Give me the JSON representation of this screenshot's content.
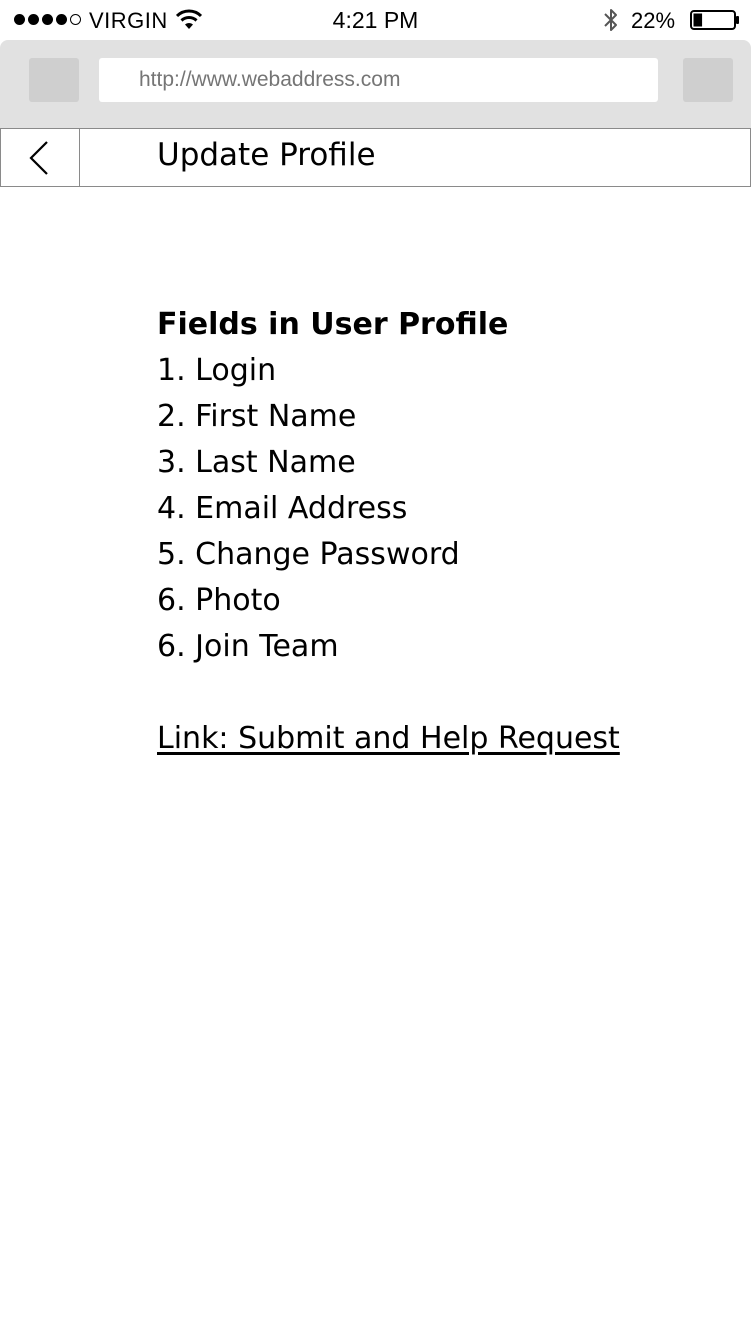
{
  "status_bar": {
    "carrier": "VIRGIN",
    "time": "4:21 PM",
    "battery_percent": "22%",
    "battery_level": 0.22,
    "signal_bars_filled": 4,
    "signal_bars_total": 5,
    "icons": [
      "wifi-icon",
      "bluetooth-icon",
      "battery-icon"
    ]
  },
  "browser": {
    "url_placeholder": "http://www.webaddress.com"
  },
  "header": {
    "back_icon": "chevron-left-icon",
    "title": "Update Profile"
  },
  "main": {
    "heading": "Fields in User Profile",
    "fields": [
      "1. Login",
      "2. First Name",
      "3. Last Name",
      "4. Email Address",
      "5. Change Password",
      "6. Photo",
      "6. Join Team"
    ],
    "help_link": "Link: Submit and Help Request"
  },
  "colors": {
    "chrome_gray": "#e1e1e1",
    "button_gray": "#cfcfcf",
    "border_gray": "#8a8a8a",
    "text": "#000000"
  }
}
